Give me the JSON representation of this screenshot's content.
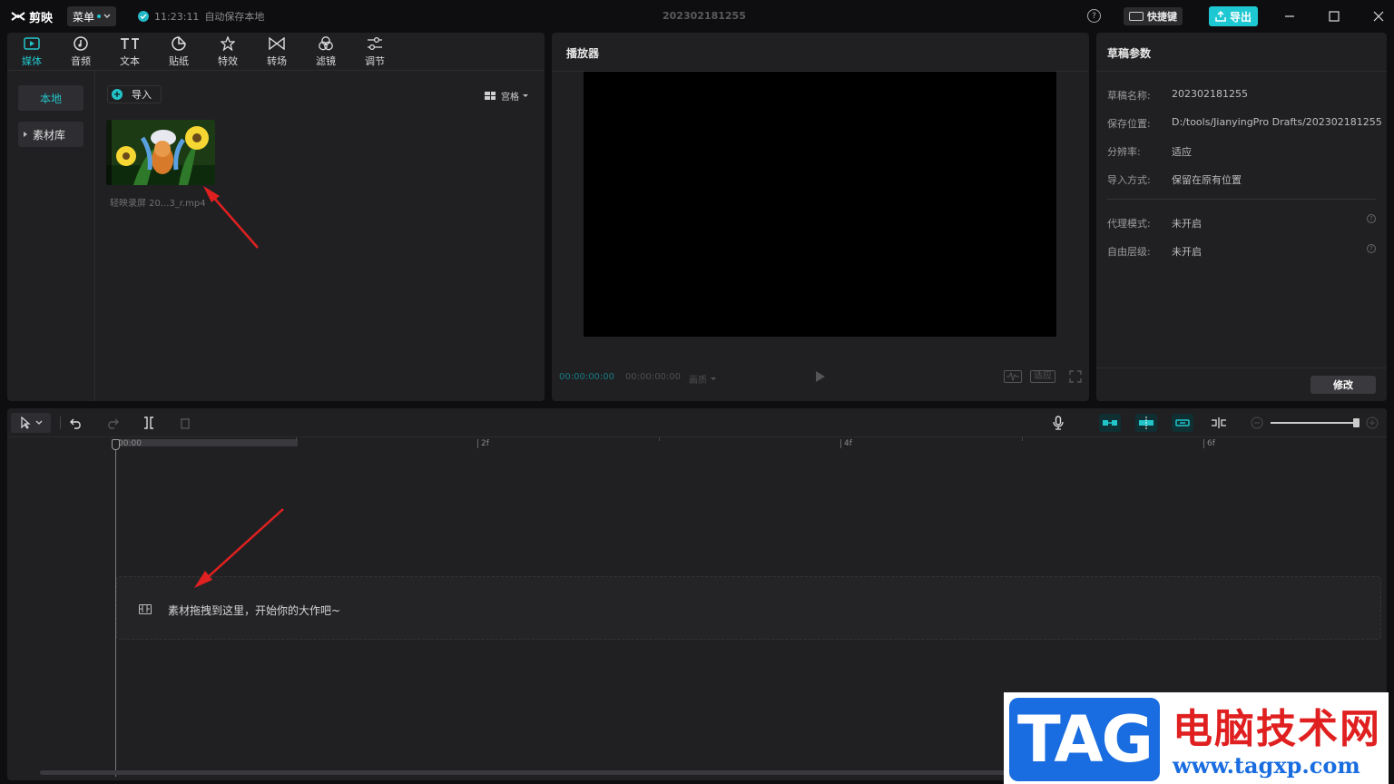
{
  "app": {
    "name": "剪映",
    "menu_label": "菜单",
    "autosave_time": "11:23:11",
    "autosave_text": "自动保存本地",
    "draft_title": "202302181255",
    "shortcut_label": "快捷键",
    "export_label": "导出"
  },
  "media_tabs": [
    {
      "label": "媒体",
      "icon": "media-icon"
    },
    {
      "label": "音频",
      "icon": "audio-icon"
    },
    {
      "label": "文本",
      "icon": "text-icon"
    },
    {
      "label": "贴纸",
      "icon": "sticker-icon"
    },
    {
      "label": "特效",
      "icon": "effects-icon"
    },
    {
      "label": "转场",
      "icon": "transition-icon"
    },
    {
      "label": "滤镜",
      "icon": "filter-icon"
    },
    {
      "label": "调节",
      "icon": "adjust-icon"
    }
  ],
  "media": {
    "side_local": "本地",
    "side_library": "素材库",
    "import_label": "导入",
    "view_label": "宫格",
    "clip_name": "轻映录屏 20...3_r.mp4"
  },
  "player": {
    "title": "播放器",
    "current_time": "00:00:00:00",
    "total_time": "00:00:00:00",
    "quality_label": "画质",
    "fit_label": "适应"
  },
  "props": {
    "title": "草稿参数",
    "rows": [
      {
        "key": "草稿名称:",
        "value": "202302181255"
      },
      {
        "key": "保存位置:",
        "value": "D:/tools/JianyingPro Drafts/202302181255"
      },
      {
        "key": "分辨率:",
        "value": "适应"
      },
      {
        "key": "导入方式:",
        "value": "保留在原有位置"
      },
      {
        "key": "代理模式:",
        "value": "未开启"
      },
      {
        "key": "自由层级:",
        "value": "未开启"
      }
    ],
    "modify_label": "修改"
  },
  "timeline": {
    "ticks": [
      "00:00",
      "2f",
      "4f",
      "6f"
    ],
    "drop_hint": "素材拖拽到这里，开始你的大作吧~"
  },
  "watermark": {
    "tag": "TAG",
    "site_name": "电脑技术网",
    "url": "www.tagxp.com"
  },
  "colors": {
    "accent": "#22c5c9",
    "annotation_arrow": "#e02020"
  }
}
